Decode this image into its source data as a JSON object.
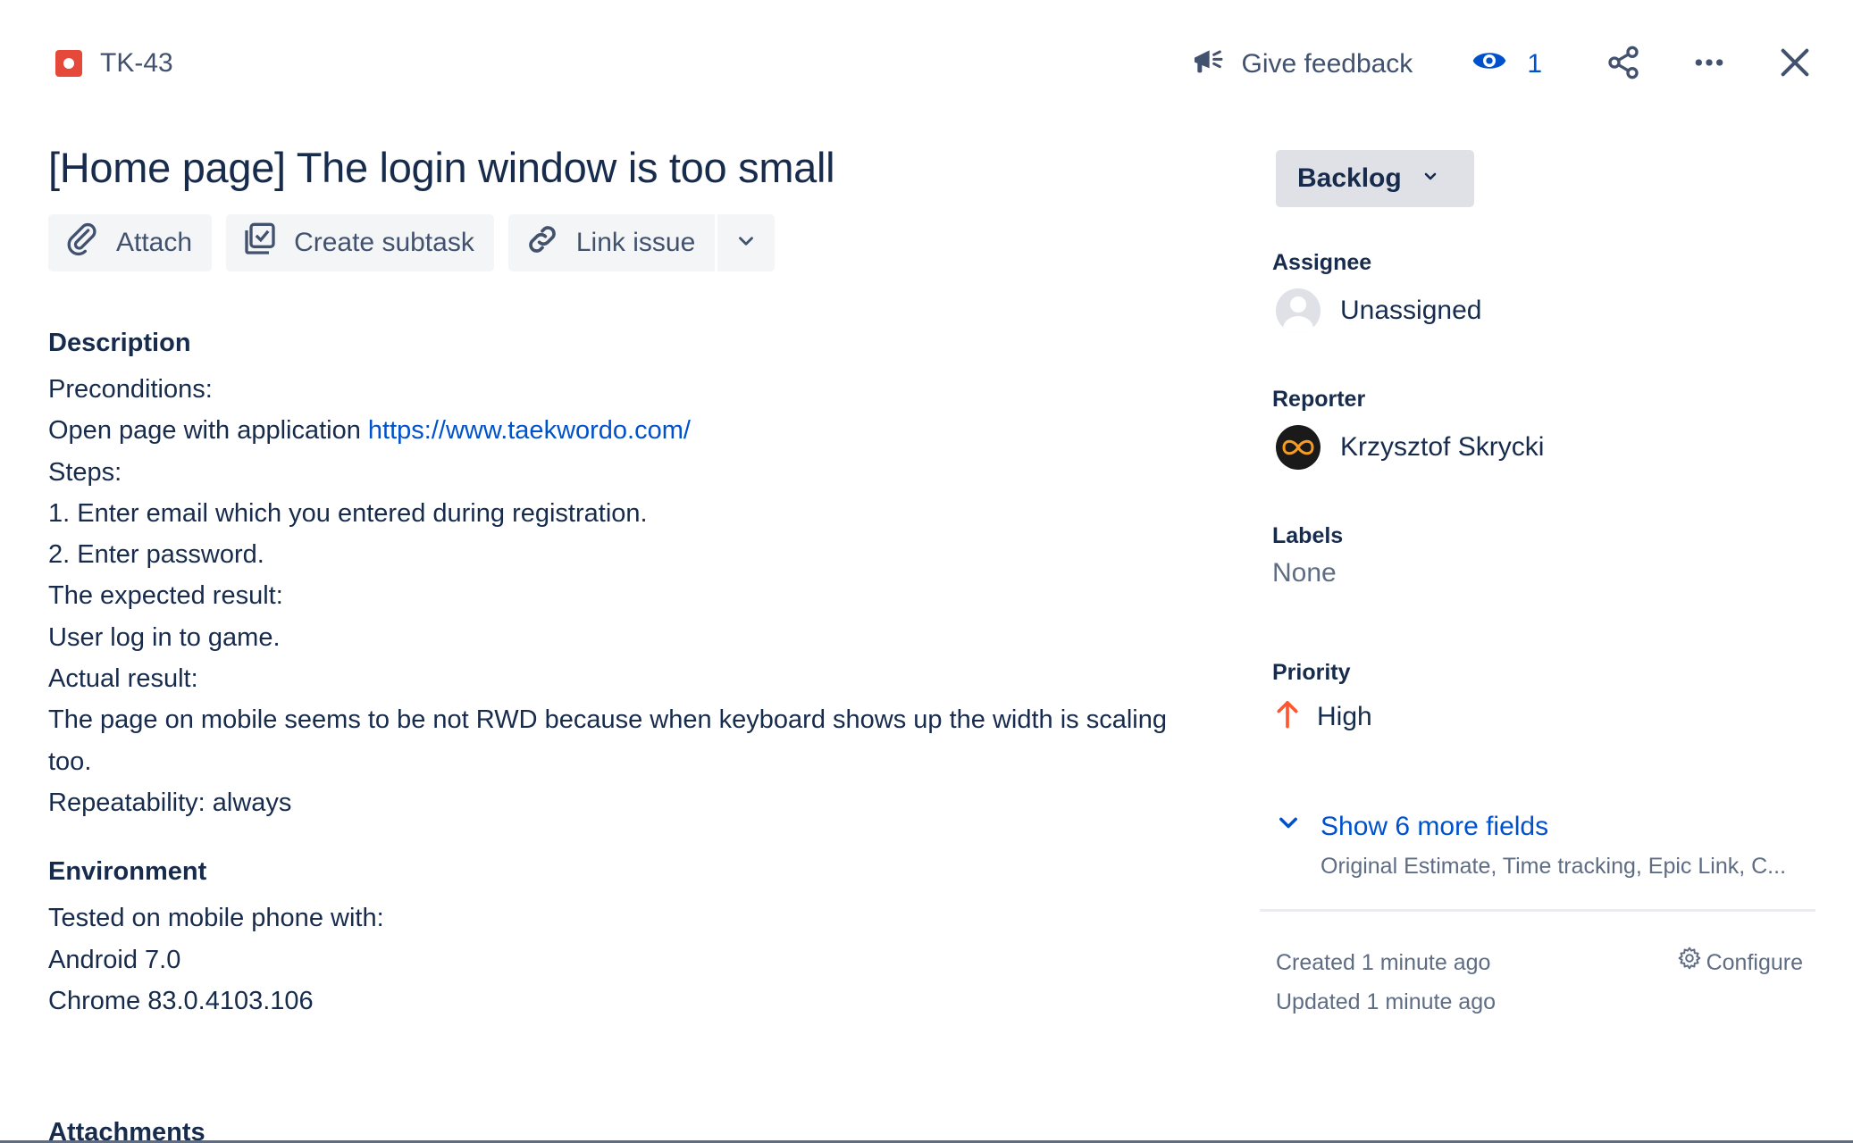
{
  "issue": {
    "key": "TK-43",
    "title": "[Home page] The login window is too small"
  },
  "top_actions": {
    "feedback_label": "Give feedback",
    "watchers_count": "1"
  },
  "toolbar": {
    "attach_label": "Attach",
    "create_subtask_label": "Create subtask",
    "link_issue_label": "Link issue"
  },
  "description": {
    "heading": "Description",
    "line1": "Preconditions:",
    "line2_prefix": "Open page with application ",
    "line2_link": "https://www.taekwordo.com/",
    "line3": "Steps:",
    "line4": "1. Enter email which you entered during registration.",
    "line5": "2. Enter password.",
    "line6": "The expected result:",
    "line7": "User log in to game.",
    "line8": "Actual result:",
    "line9": "The page on mobile seems to be not RWD because when keyboard shows up the width is scaling too.",
    "line10": "Repeatability: always"
  },
  "environment": {
    "heading": "Environment",
    "line1": "Tested on mobile phone with:",
    "line2": "Android 7.0",
    "line3": "Chrome 83.0.4103.106"
  },
  "attachments": {
    "heading": "Attachments"
  },
  "sidebar": {
    "status": "Backlog",
    "assignee_label": "Assignee",
    "assignee_value": "Unassigned",
    "reporter_label": "Reporter",
    "reporter_value": "Krzysztof Skrycki",
    "labels_label": "Labels",
    "labels_value": "None",
    "priority_label": "Priority",
    "priority_value": "High",
    "show_more": "Show 6 more fields",
    "show_more_sub": "Original Estimate, Time tracking, Epic Link, C...",
    "created": "Created 1 minute ago",
    "updated": "Updated 1 minute ago",
    "configure": "Configure"
  },
  "colors": {
    "bug_red": "#e5493a",
    "link_blue": "#0052cc",
    "priority_red": "#ff5630",
    "text_dark": "#172b4d",
    "text_subtle": "#5e6c84"
  }
}
